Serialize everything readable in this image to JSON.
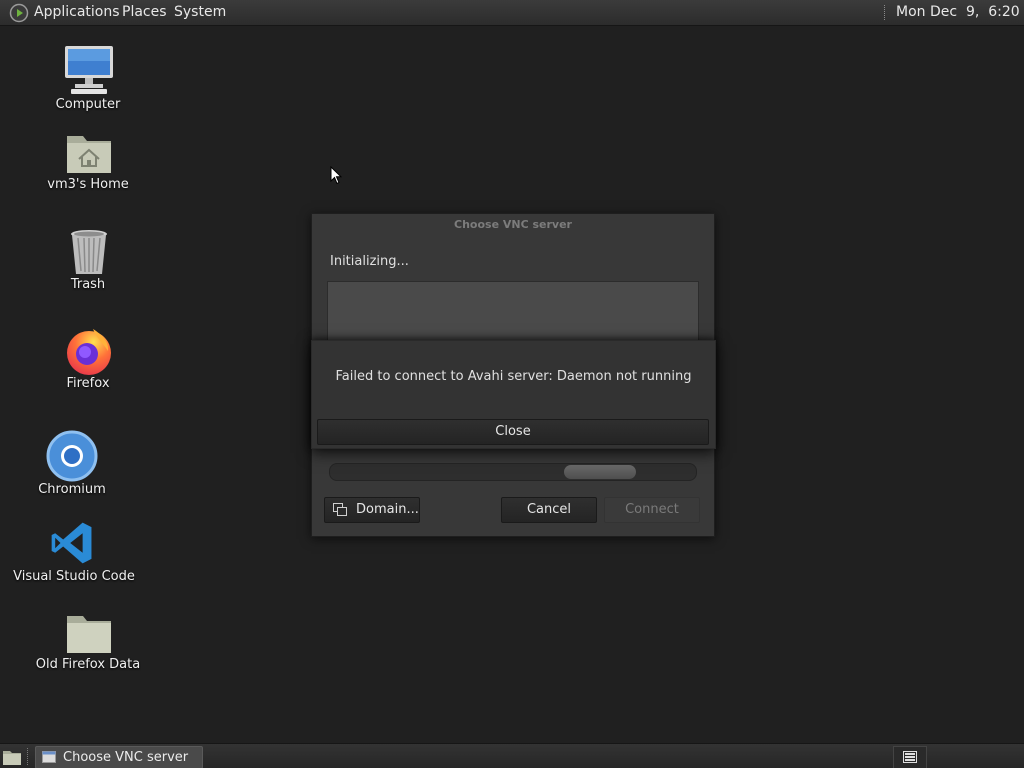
{
  "top_panel": {
    "menus": [
      "Applications",
      "Places",
      "System"
    ],
    "clock": "Mon Dec  9,  6:20 AM"
  },
  "desktop_icons": [
    {
      "label": "Computer",
      "icon": "computer-icon"
    },
    {
      "label": "vm3's Home",
      "icon": "home-folder-icon"
    },
    {
      "label": "Trash",
      "icon": "trash-icon"
    },
    {
      "label": "Firefox",
      "icon": "firefox-icon"
    },
    {
      "label": "Chromium",
      "icon": "chromium-icon"
    },
    {
      "label": "Visual Studio Code",
      "icon": "vscode-icon"
    },
    {
      "label": "Old Firefox Data",
      "icon": "folder-icon"
    }
  ],
  "vnc_dialog": {
    "title": "Choose VNC server",
    "status": "Initializing...",
    "domain_button": "Domain...",
    "cancel_button": "Cancel",
    "connect_button": "Connect"
  },
  "error_dialog": {
    "message": "Failed to connect to Avahi server: Daemon not running",
    "close_button": "Close"
  },
  "taskbar": {
    "window_button": "Choose VNC server"
  },
  "colors": {
    "panel_bg": "#2f2f2f",
    "desktop_bg": "#202020",
    "dialog_bg": "#383838",
    "firefox_orange": "#ff7139",
    "chromium_blue": "#4a8fd9",
    "vscode_blue": "#2a8bd6"
  }
}
